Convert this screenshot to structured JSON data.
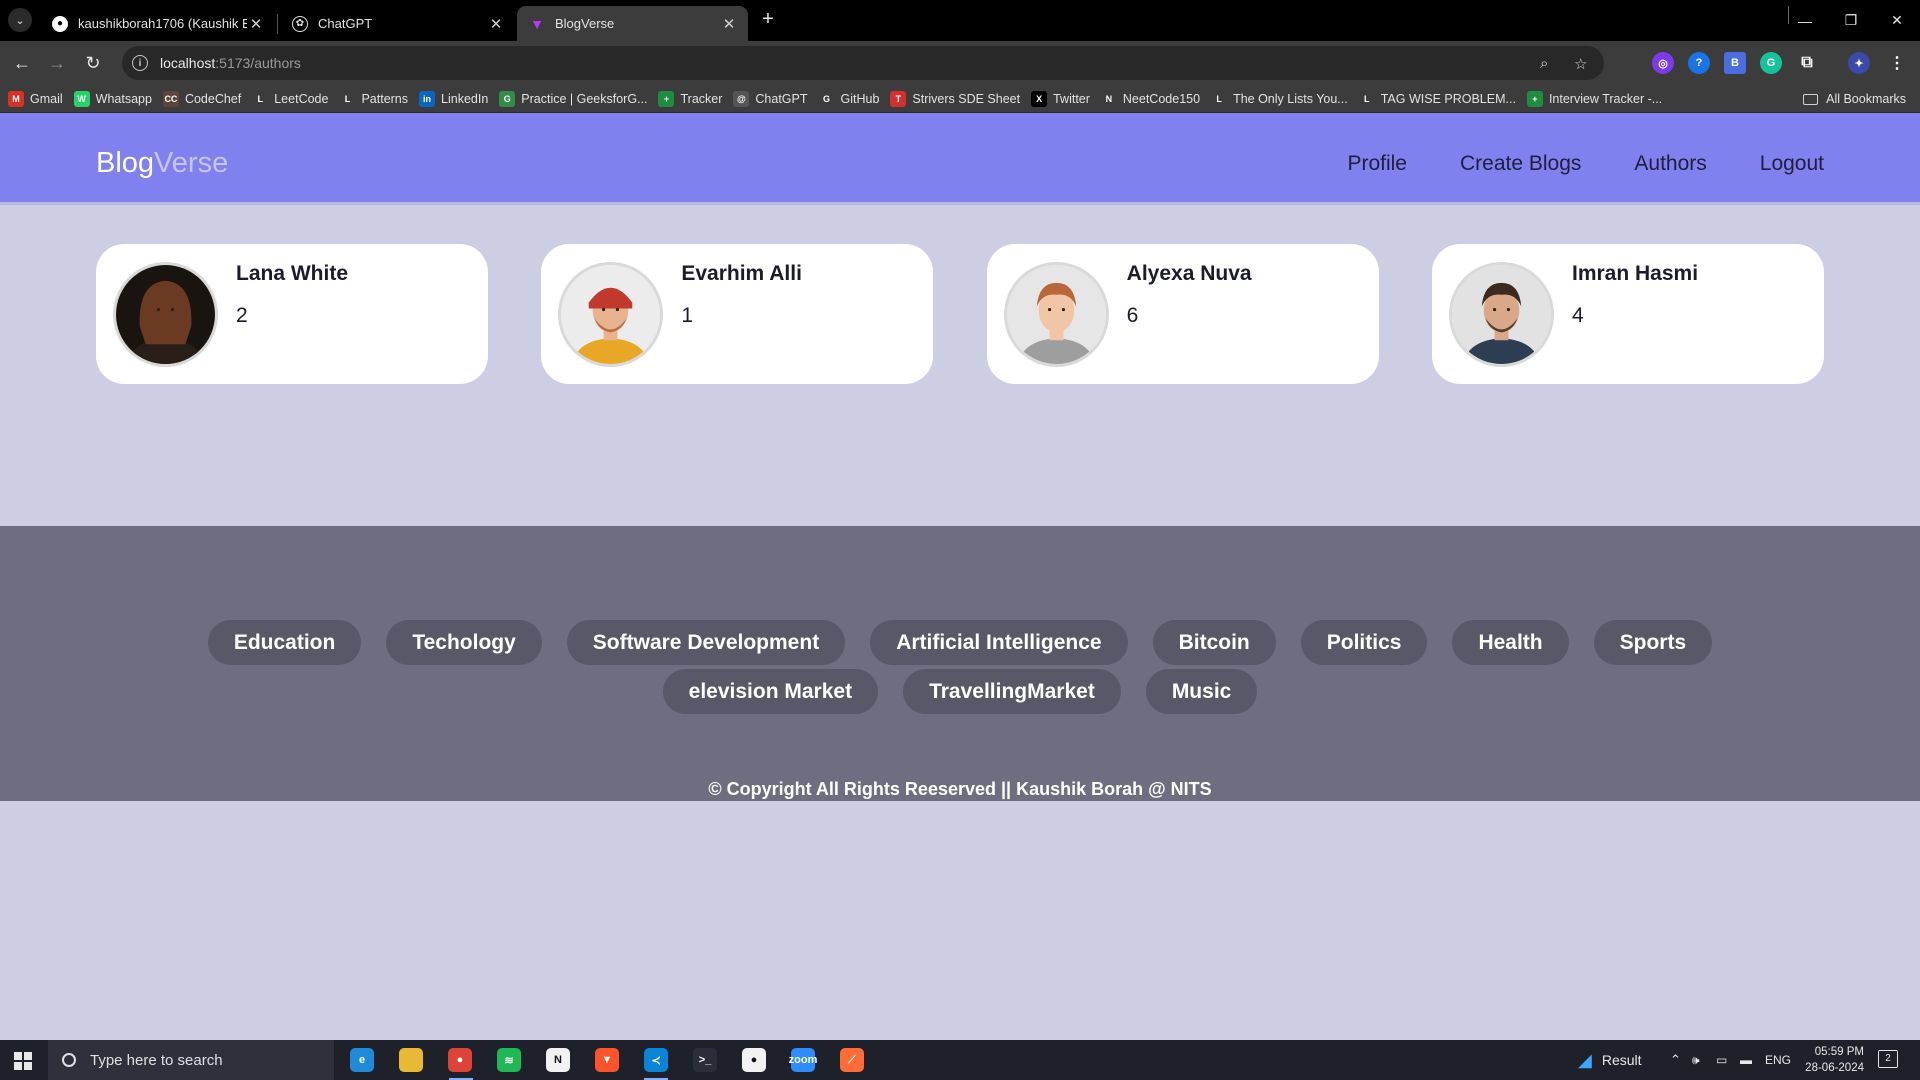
{
  "browser": {
    "tabs": [
      {
        "title": "kaushikborah1706 (Kaushik Bor",
        "icon": "github-icon",
        "active": false
      },
      {
        "title": "ChatGPT",
        "icon": "chatgpt-icon",
        "active": false
      },
      {
        "title": "BlogVerse",
        "icon": "vite-icon",
        "active": true
      }
    ],
    "new_tab_glyph": "+",
    "tab_close_glyph": "✕",
    "url_host": "localhost",
    "url_path": ":5173/authors",
    "bookmarks": [
      {
        "label": "Gmail",
        "icon": "gmail-icon",
        "color": "#d93025",
        "glyph": "M"
      },
      {
        "label": "Whatsapp",
        "icon": "whatsapp-icon",
        "color": "#25d366",
        "glyph": "W"
      },
      {
        "label": "CodeChef",
        "icon": "codechef-icon",
        "color": "#5b4638",
        "glyph": "CC"
      },
      {
        "label": "LeetCode",
        "icon": "leetcode-icon",
        "color": "#3c3c3c",
        "glyph": "L"
      },
      {
        "label": "Patterns",
        "icon": "leetcode-icon",
        "color": "#3c3c3c",
        "glyph": "L"
      },
      {
        "label": "LinkedIn",
        "icon": "linkedin-icon",
        "color": "#0a66c2",
        "glyph": "in"
      },
      {
        "label": "Practice | GeeksforG...",
        "icon": "geeksforgeeks-icon",
        "color": "#2f8d46",
        "glyph": "G"
      },
      {
        "label": "Tracker",
        "icon": "sheets-icon",
        "color": "#1e8e3e",
        "glyph": "+"
      },
      {
        "label": "ChatGPT",
        "icon": "chatgpt-icon",
        "color": "#555555",
        "glyph": "@"
      },
      {
        "label": "GitHub",
        "icon": "github-icon",
        "color": "#3c3c3c",
        "glyph": "G"
      },
      {
        "label": "Strivers SDE Sheet",
        "icon": "tuf-icon",
        "color": "#d32f2f",
        "glyph": "T"
      },
      {
        "label": "Twitter",
        "icon": "x-icon",
        "color": "#000000",
        "glyph": "X"
      },
      {
        "label": "NeetCode150",
        "icon": "neetcode-icon",
        "color": "#3c3c3c",
        "glyph": "N"
      },
      {
        "label": "The Only Lists You...",
        "icon": "leetcode-icon",
        "color": "#3c3c3c",
        "glyph": "L"
      },
      {
        "label": "TAG WISE PROBLEM...",
        "icon": "leetcode-icon",
        "color": "#3c3c3c",
        "glyph": "L"
      },
      {
        "label": "Interview Tracker -...",
        "icon": "sheets-icon",
        "color": "#1e8e3e",
        "glyph": "+"
      }
    ],
    "all_bookmarks": "All Bookmarks"
  },
  "site": {
    "logo_part1": "Blog",
    "logo_part2": "Verse",
    "nav": [
      "Profile",
      "Create Blogs",
      "Authors",
      "Logout"
    ]
  },
  "authors": [
    {
      "name": "Lana White",
      "count": "2",
      "avatar": "woman-dark-hair",
      "bg": "#1a1410",
      "skin": "#d9a07e",
      "hair": "#6b3a22",
      "shirt": "#2a1e18"
    },
    {
      "name": "Evarhim Alli",
      "count": "1",
      "avatar": "man-red-beanie",
      "bg": "#ececec",
      "skin": "#e8b48f",
      "hair": "#c0392b",
      "shirt": "#e8a825"
    },
    {
      "name": "Alyexa Nuva",
      "count": "6",
      "avatar": "kid-ginger-hair",
      "bg": "#e6e6e6",
      "skin": "#f0c6a6",
      "hair": "#b9673a",
      "shirt": "#9e9e9e"
    },
    {
      "name": "Imran Hasmi",
      "count": "4",
      "avatar": "man-beard",
      "bg": "#e2e2e2",
      "skin": "#d8a888",
      "hair": "#3b2a20",
      "shirt": "#2d3e52"
    }
  ],
  "footer": {
    "tags": [
      "Education",
      "Techology",
      "Software Development",
      "Artificial Intelligence",
      "Bitcoin",
      "Politics",
      "Health",
      "Sports",
      "elevision Market",
      "TravellingMarket",
      "Music"
    ],
    "copyright": "© Copyright All Rights Reeserved || Kaushik Borah @ NITS"
  },
  "taskbar": {
    "search_placeholder": "Type here to search",
    "apps": [
      {
        "name": "edge-icon",
        "color": "#1f8ad8",
        "glyph": "e"
      },
      {
        "name": "file-explorer-icon",
        "color": "#e8b932",
        "glyph": ""
      },
      {
        "name": "chrome-icon",
        "color": "#db4437",
        "glyph": "●"
      },
      {
        "name": "spotify-icon",
        "color": "#1db954",
        "glyph": "≋"
      },
      {
        "name": "notion-icon",
        "color": "#f2f2f2",
        "glyph": "N"
      },
      {
        "name": "brave-icon",
        "color": "#fb542b",
        "glyph": "▼"
      },
      {
        "name": "vscode-icon",
        "color": "#0a84d6",
        "glyph": "≺"
      },
      {
        "name": "terminal-icon",
        "color": "#2c2c3a",
        "glyph": ">_"
      },
      {
        "name": "mongodb-compass-icon",
        "color": "#f2f2f2",
        "glyph": "●"
      },
      {
        "name": "zoom-icon",
        "color": "#2d8cff",
        "glyph": "zoom"
      },
      {
        "name": "postman-icon",
        "color": "#ff6c37",
        "glyph": "⟋"
      }
    ],
    "weather_label": "Result",
    "language": "ENG",
    "time": "05:59 PM",
    "date": "28-06-2024",
    "notification_count": "2"
  }
}
